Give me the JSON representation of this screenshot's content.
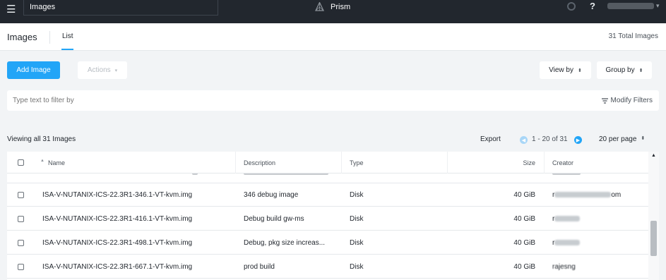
{
  "topbar": {
    "search_value": "Images",
    "brand_name": "Prism",
    "help_label": "?",
    "menu_icon": "hamburger-icon",
    "user_name": "[redacted]"
  },
  "header": {
    "title": "Images",
    "tab_list": "List",
    "total": "31 Total Images"
  },
  "toolbar": {
    "add_image": "Add Image",
    "actions": "Actions",
    "view_by": "View by",
    "group_by": "Group by"
  },
  "filter": {
    "placeholder": "Type text to filter by",
    "modify": "Modify Filters"
  },
  "list": {
    "viewing": "Viewing all 31 Images",
    "export": "Export",
    "page_range": "1 - 20 of 31",
    "per_page": "20 per page"
  },
  "table": {
    "columns": {
      "name": "Name",
      "description": "Description",
      "type": "Type",
      "size": "Size",
      "creator": "Creator"
    },
    "rows": [
      {
        "name": "ISA-V-NUTANIX-ICS-22.3R1-346.1-VT-kvm.img",
        "description": "346 debug image",
        "type": "Disk",
        "size": "40 GiB",
        "creator_prefix": "r",
        "creator_suffix": "om"
      },
      {
        "name": "ISA-V-NUTANIX-ICS-22.3R1-416.1-VT-kvm.img",
        "description": "Debug build gw-ms",
        "type": "Disk",
        "size": "40 GiB",
        "creator_prefix": "r",
        "creator_suffix": ""
      },
      {
        "name": "ISA-V-NUTANIX-ICS-22.3R1-498.1-VT-kvm.img",
        "description": "Debug, pkg size increas...",
        "type": "Disk",
        "size": "40 GiB",
        "creator_prefix": "r",
        "creator_suffix": ""
      },
      {
        "name": "ISA-V-NUTANIX-ICS-22.3R1-667.1-VT-kvm.img",
        "description": "prod build",
        "type": "Disk",
        "size": "40 GiB",
        "creator_prefix": "rajesng",
        "creator_suffix": ""
      }
    ]
  },
  "colors": {
    "topbar": "#22272e",
    "accent": "#22a5f7",
    "page_bg": "#f2f4f6"
  }
}
